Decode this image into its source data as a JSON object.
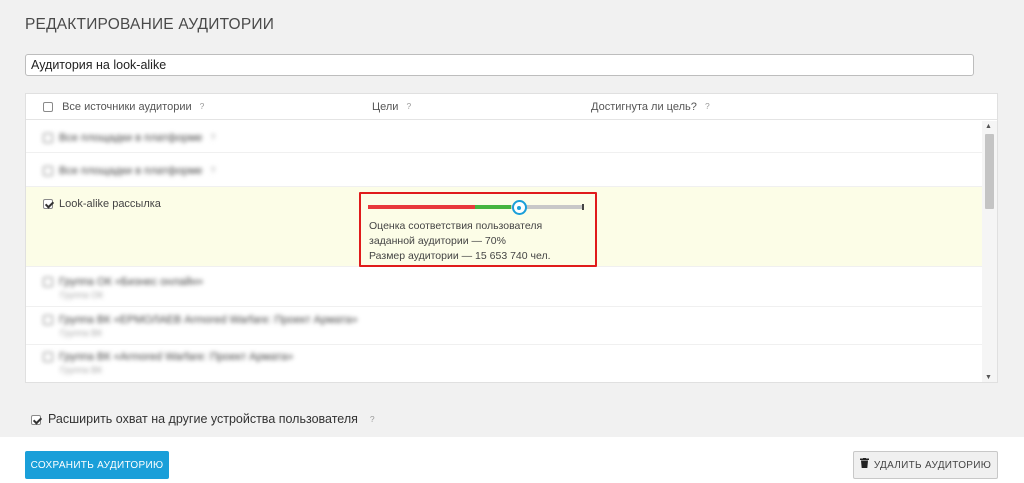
{
  "header": {
    "title": "РЕДАКТИРОВАНИЕ АУДИТОРИИ"
  },
  "audience_name": {
    "value": "Аудитория на look-alike"
  },
  "table": {
    "columns": {
      "sources": "Все источники аудитории",
      "goals": "Цели",
      "goal_reached": "Достигнута ли цель?",
      "help": "?"
    },
    "rows": [
      {
        "label": "Все площадки в платформе",
        "sub": "",
        "checked": false,
        "blurred": true
      },
      {
        "label": "Все площадки в платформе",
        "sub": "",
        "checked": false,
        "blurred": true
      },
      {
        "label": "Look-alike рассылка",
        "sub": "",
        "checked": true,
        "blurred": false,
        "highlighted": true
      },
      {
        "label": "Группа ОК «Бизнес онлайн»",
        "sub": "Группа ОК",
        "checked": false,
        "blurred": true
      },
      {
        "label": "Группа ВК «ЕРМОЛАЕВ Armored Warfare: Проект Армата»",
        "sub": "Группа ВК",
        "checked": false,
        "blurred": true
      },
      {
        "label": "Группа ВК «Armored Warfare: Проект Армата»",
        "sub": "Группа ВК",
        "checked": false,
        "blurred": true
      }
    ]
  },
  "score": {
    "match_percent": 70,
    "line1": "Оценка соответствия пользователя",
    "line2": "заданной аудитории — 70%",
    "line3": "Размер аудитории — 15 653 740 чел.",
    "colors": {
      "low": "#e8383b",
      "mid": "#45b43f",
      "rest": "#c8c8c8",
      "knob": "#1a9fd9",
      "highlight_border": "#e01b1b"
    }
  },
  "extend_reach": {
    "label": "Расширить охват на другие устройства пользователя",
    "checked": true
  },
  "buttons": {
    "save": "СОХРАНИТЬ АУДИТОРИЮ",
    "delete": "УДАЛИТЬ АУДИТОРИЮ"
  },
  "icons": {
    "trash": "trash-icon",
    "help": "help-icon",
    "scroll_up": "arrow-up-icon",
    "scroll_down": "arrow-down-icon"
  }
}
